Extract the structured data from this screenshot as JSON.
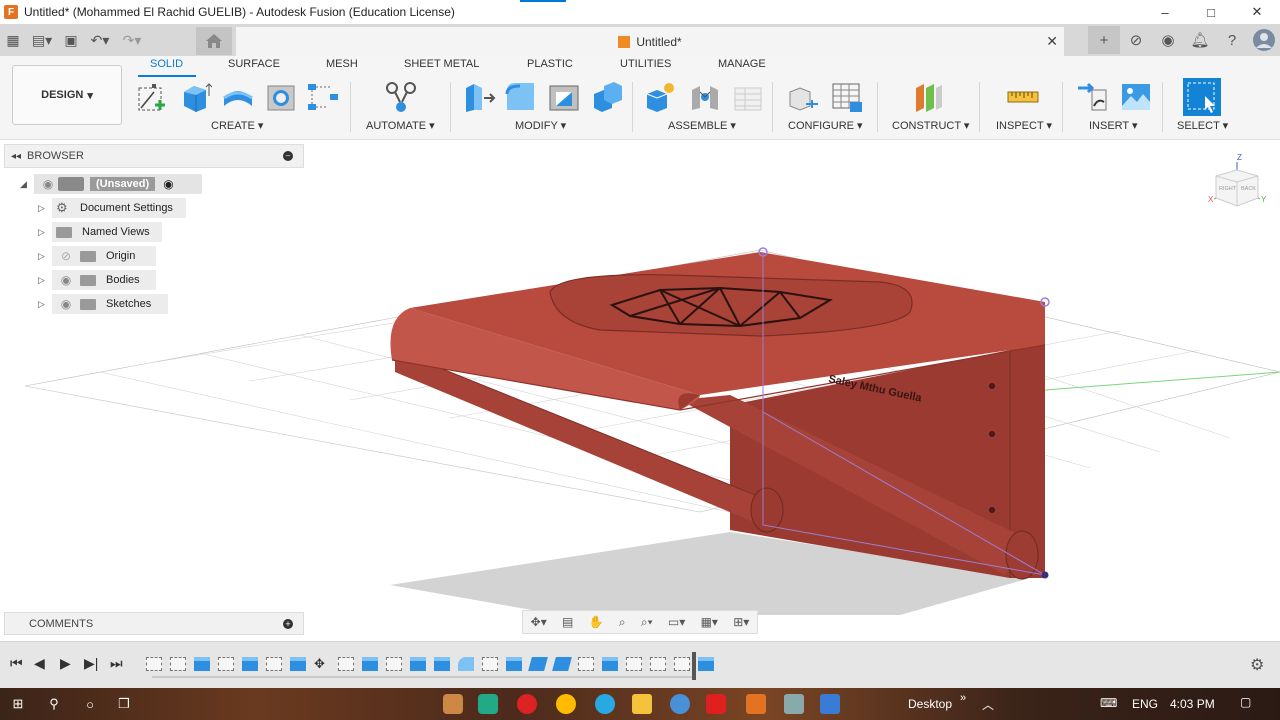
{
  "window": {
    "title": "Untitled* (Mohammed El Rachid GUELIB) - Autodesk Fusion (Education License)",
    "app_logo": "F",
    "controls": [
      "–",
      "□",
      "✕"
    ]
  },
  "doc_tab": {
    "title": "Untitled*"
  },
  "ribbon": {
    "design_label": "DESIGN",
    "tabs": [
      "SOLID",
      "SURFACE",
      "MESH",
      "SHEET METAL",
      "PLASTIC",
      "UTILITIES",
      "MANAGE"
    ],
    "groups": {
      "create": "CREATE",
      "automate": "AUTOMATE",
      "modify": "MODIFY",
      "assemble": "ASSEMBLE",
      "configure": "CONFIGURE",
      "construct": "CONSTRUCT",
      "inspect": "INSPECT",
      "insert": "INSERT",
      "select": "SELECT"
    }
  },
  "browser": {
    "title": "BROWSER",
    "root": "(Unsaved)",
    "items": [
      {
        "label": "Document Settings",
        "icon": "gear-icon"
      },
      {
        "label": "Named Views",
        "icon": "folder-icon"
      },
      {
        "label": "Origin",
        "icon": "folder-icon"
      },
      {
        "label": "Bodies",
        "icon": "folder-icon"
      },
      {
        "label": "Sketches",
        "icon": "folder-icon"
      }
    ]
  },
  "viewcube": {
    "top": "Z",
    "right_face": "RIGHT",
    "back_face": "BACK",
    "x_axis": "X",
    "y_axis": "Y"
  },
  "model": {
    "color": "#b5483c",
    "engraved_text": "Saley Mthu Guella"
  },
  "comments": {
    "title": "COMMENTS"
  },
  "taskbar": {
    "desktop_label": "Desktop",
    "language": "ENG",
    "time": "4:03 PM"
  }
}
